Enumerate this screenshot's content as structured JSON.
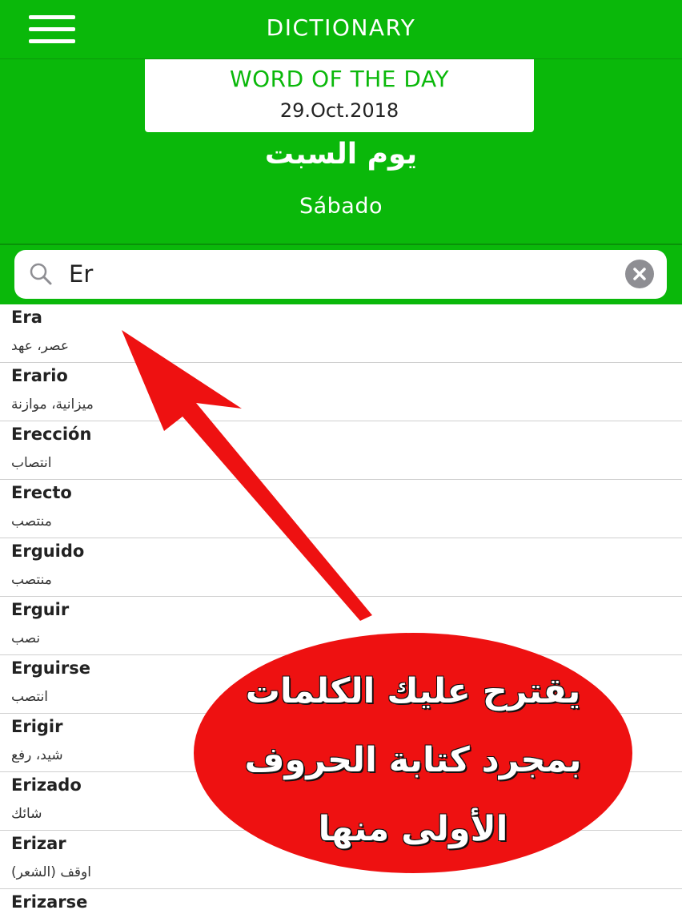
{
  "header": {
    "title": "DICTIONARY",
    "menu_icon": "hamburger-menu-icon"
  },
  "word_of_the_day": {
    "heading": "WORD OF THE DAY",
    "date": "29.Oct.2018",
    "arabic": "يوم السبت",
    "spanish": "Sábado"
  },
  "search": {
    "value": "Er",
    "search_icon": "search-icon",
    "clear_icon": "clear-icon"
  },
  "results": [
    {
      "term": "Era",
      "translation": "عصر، عهد"
    },
    {
      "term": "Erario",
      "translation": "ميزانية، موازنة"
    },
    {
      "term": "Erección",
      "translation": "انتصاب"
    },
    {
      "term": "Erecto",
      "translation": "منتصب"
    },
    {
      "term": "Erguido",
      "translation": "منتصب"
    },
    {
      "term": "Erguir",
      "translation": "نصب"
    },
    {
      "term": "Erguirse",
      "translation": "انتصب"
    },
    {
      "term": "Erigir",
      "translation": "شيد، رفع"
    },
    {
      "term": "Erizado",
      "translation": "شائك"
    },
    {
      "term": "Erizar",
      "translation": "اوقف (الشعر)"
    },
    {
      "term": "Erizarse",
      "translation": ""
    }
  ],
  "annotation": {
    "lines": [
      "يقترح عليك الكلمات",
      "بمجرد كتابة الحروف",
      "الأولى منها"
    ],
    "color": "#ee1111"
  },
  "colors": {
    "brand_green": "#0ab80a",
    "annotation_red": "#ee1111"
  }
}
